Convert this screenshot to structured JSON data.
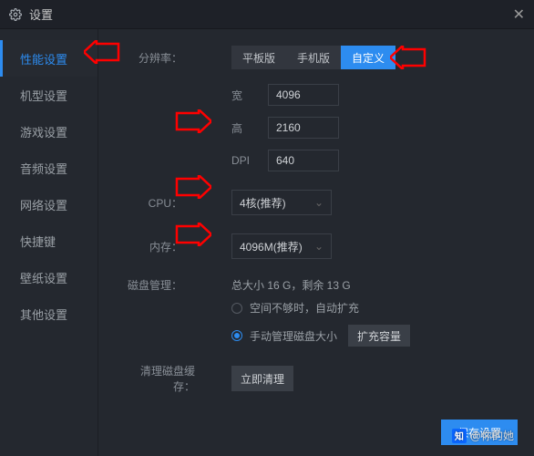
{
  "title": "设置",
  "sidebar": {
    "items": [
      {
        "label": "性能设置"
      },
      {
        "label": "机型设置"
      },
      {
        "label": "游戏设置"
      },
      {
        "label": "音频设置"
      },
      {
        "label": "网络设置"
      },
      {
        "label": "快捷键"
      },
      {
        "label": "壁纸设置"
      },
      {
        "label": "其他设置"
      }
    ]
  },
  "resolution": {
    "label": "分辨率：",
    "tabs": [
      "平板版",
      "手机版",
      "自定义"
    ],
    "width_label": "宽",
    "width": "4096",
    "height_label": "高",
    "height": "2160",
    "dpi_label": "DPI",
    "dpi": "640"
  },
  "cpu": {
    "label": "CPU：",
    "value": "4核(推荐)"
  },
  "memory": {
    "label": "内存：",
    "value": "4096M(推荐)"
  },
  "disk": {
    "label": "磁盘管理：",
    "info": "总大小 16 G，剩余 13 G",
    "opt_auto": "空间不够时，自动扩充",
    "opt_manual": "手动管理磁盘大小",
    "expand_btn": "扩充容量"
  },
  "clear": {
    "label": "清理磁盘缓存：",
    "btn": "立即清理"
  },
  "save_btn": "保存设置",
  "watermark": "@你的她",
  "zh": "知乎"
}
